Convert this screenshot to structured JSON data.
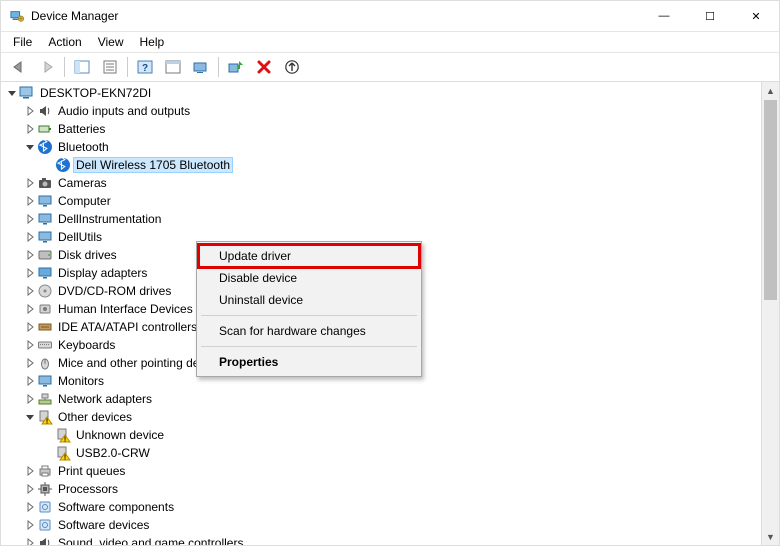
{
  "window": {
    "title": "Device Manager"
  },
  "window_controls": {
    "minimize": "—",
    "maximize": "☐",
    "close": "✕"
  },
  "menu": {
    "file": "File",
    "action": "Action",
    "view": "View",
    "help": "Help"
  },
  "toolbar": {
    "back": "back",
    "forward": "forward",
    "show_hide_tree": "show-hide-console-tree",
    "properties": "properties",
    "help": "help",
    "show_hidden": "show-hidden-devices",
    "devices_by_type": "devices-by-type",
    "scan_hardware": "scan-for-hardware-changes",
    "remove": "remove",
    "update_driver": "update-driver"
  },
  "tree": {
    "root": "DESKTOP-EKN72DI",
    "nodes": [
      {
        "label": "Audio inputs and outputs",
        "icon": "speaker-icon",
        "expanded": false
      },
      {
        "label": "Batteries",
        "icon": "battery-icon",
        "expanded": false
      },
      {
        "label": "Bluetooth",
        "icon": "bluetooth-icon",
        "expanded": true,
        "children": [
          {
            "label": "Dell Wireless 1705 Bluetooth",
            "icon": "bluetooth-icon",
            "selected": true
          }
        ]
      },
      {
        "label": "Cameras",
        "icon": "camera-icon",
        "expanded": false
      },
      {
        "label": "Computer",
        "icon": "monitor-icon",
        "expanded": false
      },
      {
        "label": "DellInstrumentation",
        "icon": "monitor-icon",
        "expanded": false
      },
      {
        "label": "DellUtils",
        "icon": "monitor-icon",
        "expanded": false
      },
      {
        "label": "Disk drives",
        "icon": "disk-icon",
        "expanded": false
      },
      {
        "label": "Display adapters",
        "icon": "display-adapter-icon",
        "expanded": false
      },
      {
        "label": "DVD/CD-ROM drives",
        "icon": "optical-drive-icon",
        "expanded": false
      },
      {
        "label": "Human Interface Devices",
        "icon": "hid-icon",
        "expanded": false
      },
      {
        "label": "IDE ATA/ATAPI controllers",
        "icon": "ide-icon",
        "expanded": false
      },
      {
        "label": "Keyboards",
        "icon": "keyboard-icon",
        "expanded": false
      },
      {
        "label": "Mice and other pointing devices",
        "icon": "mouse-icon",
        "expanded": false
      },
      {
        "label": "Monitors",
        "icon": "monitor-icon",
        "expanded": false
      },
      {
        "label": "Network adapters",
        "icon": "network-icon",
        "expanded": false
      },
      {
        "label": "Other devices",
        "icon": "warning-device-icon",
        "expanded": true,
        "children": [
          {
            "label": "Unknown device",
            "icon": "warning-device-icon"
          },
          {
            "label": "USB2.0-CRW",
            "icon": "warning-device-icon"
          }
        ]
      },
      {
        "label": "Print queues",
        "icon": "printer-icon",
        "expanded": false
      },
      {
        "label": "Processors",
        "icon": "cpu-icon",
        "expanded": false
      },
      {
        "label": "Software components",
        "icon": "software-icon",
        "expanded": false
      },
      {
        "label": "Software devices",
        "icon": "software-icon",
        "expanded": false
      },
      {
        "label": "Sound, video and game controllers",
        "icon": "speaker-icon",
        "expanded": false
      }
    ]
  },
  "context_menu": {
    "items": [
      {
        "label": "Update driver",
        "highlight": true
      },
      {
        "label": "Disable device"
      },
      {
        "label": "Uninstall device"
      },
      {
        "separator": true
      },
      {
        "label": "Scan for hardware changes"
      },
      {
        "separator": true
      },
      {
        "label": "Properties",
        "bold": true
      }
    ]
  }
}
